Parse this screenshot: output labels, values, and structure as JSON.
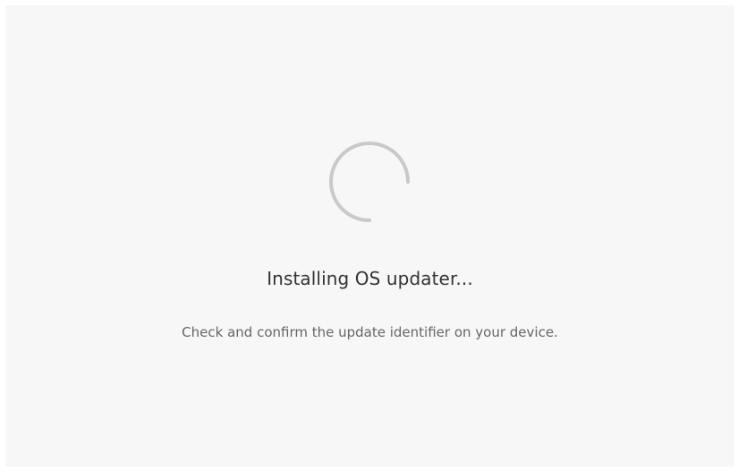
{
  "installer": {
    "title": "Installing OS updater...",
    "message": "Check and confirm the update identifier on your device.",
    "spinner_icon": "loading-spinner-icon"
  },
  "colors": {
    "background": "#ffffff",
    "panel": "#f7f7f7",
    "spinner": "#c9c9c9",
    "title": "#333333",
    "message": "#666666"
  }
}
